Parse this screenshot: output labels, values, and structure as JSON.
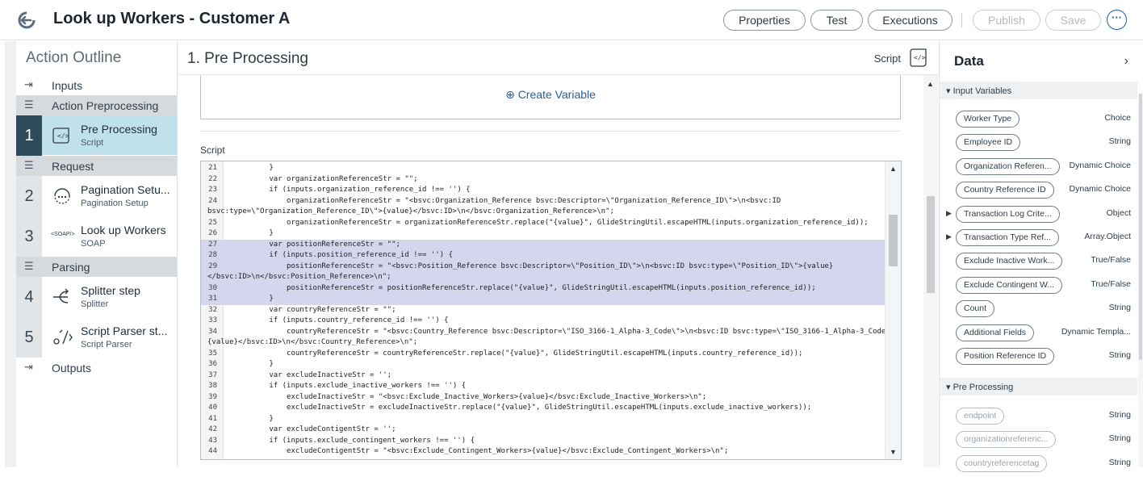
{
  "header": {
    "title": "Look up Workers - Customer A",
    "buttons": {
      "properties": "Properties",
      "test": "Test",
      "executions": "Executions",
      "publish": "Publish",
      "save": "Save",
      "more": "···"
    }
  },
  "outline": {
    "title": "Action Outline",
    "inputs": "Inputs",
    "outputs": "Outputs",
    "sections": [
      "Action Preprocessing",
      "Request",
      "Parsing"
    ],
    "steps": [
      {
        "num": "1",
        "title": "Pre Processing",
        "sub": "Script",
        "icon": "script-icon"
      },
      {
        "num": "2",
        "title": "Pagination Setu...",
        "sub": "Pagination Setup",
        "icon": "pagination-icon"
      },
      {
        "num": "3",
        "title": "Look up Workers",
        "sub": "SOAP",
        "icon": "soap-icon",
        "icon_text": "<SOAP/>"
      },
      {
        "num": "4",
        "title": "Splitter step",
        "sub": "Splitter",
        "icon": "splitter-icon"
      },
      {
        "num": "5",
        "title": "Script Parser st...",
        "sub": "Script Parser",
        "icon": "script-parser-icon"
      }
    ]
  },
  "main": {
    "step_number": "1.",
    "title": "Pre Processing",
    "script_type_label": "Script",
    "create_variable": "Create Variable",
    "script_label": "Script",
    "code_lines": [
      {
        "n": "21",
        "t": "        }"
      },
      {
        "n": "22",
        "t": "        var organizationReferenceStr = \"\";"
      },
      {
        "n": "23",
        "t": "        if (inputs.organization_reference_id !== '') {"
      },
      {
        "n": "24",
        "t": "            organizationReferenceStr = \"<bsvc:Organization_Reference bsvc:Descriptor=\\\"Organization_Reference_ID\\\">\\n<bsvc:ID"
      },
      {
        "n": "",
        "t": "bsvc:type=\\\"Organization_Reference_ID\\\">{value}</bsvc:ID>\\n</bsvc:Organization_Reference>\\n\";"
      },
      {
        "n": "25",
        "t": "            organizationReferenceStr = organizationReferenceStr.replace(\"{value}\", GlideStringUtil.escapeHTML(inputs.organization_reference_id));"
      },
      {
        "n": "26",
        "t": "        }"
      },
      {
        "n": "27",
        "t": "        var positionReferenceStr = \"\";",
        "hl": true
      },
      {
        "n": "28",
        "t": "        if (inputs.position_reference_id !== '') {",
        "hl": true
      },
      {
        "n": "29",
        "t": "            positionReferenceStr = \"<bsvc:Position_Reference bsvc:Descriptor=\\\"Position_ID\\\">\\n<bsvc:ID bsvc:type=\\\"Position_ID\\\">{value}",
        "hl": true
      },
      {
        "n": "",
        "t": "</bsvc:ID>\\n</bsvc:Position_Reference>\\n\";",
        "hl": true
      },
      {
        "n": "30",
        "t": "            positionReferenceStr = positionReferenceStr.replace(\"{value}\", GlideStringUtil.escapeHTML(inputs.position_reference_id));",
        "hl": true
      },
      {
        "n": "31",
        "t": "        }",
        "hl": true
      },
      {
        "n": "32",
        "t": "        var countryReferenceStr = \"\";"
      },
      {
        "n": "33",
        "t": "        if (inputs.country_reference_id !== '') {"
      },
      {
        "n": "34",
        "t": "            countryReferenceStr = \"<bsvc:Country_Reference bsvc:Descriptor=\\\"ISO_3166-1_Alpha-3_Code\\\">\\n<bsvc:ID bsvc:type=\\\"ISO_3166-1_Alpha-3_Code\\\">"
      },
      {
        "n": "",
        "t": "{value}</bsvc:ID>\\n</bsvc:Country_Reference>\\n\";"
      },
      {
        "n": "35",
        "t": "            countryReferenceStr = countryReferenceStr.replace(\"{value}\", GlideStringUtil.escapeHTML(inputs.country_reference_id));"
      },
      {
        "n": "36",
        "t": "        }"
      },
      {
        "n": "37",
        "t": "        var excludeInactiveStr = '';"
      },
      {
        "n": "38",
        "t": "        if (inputs.exclude_inactive_workers !== '') {"
      },
      {
        "n": "39",
        "t": "            excludeInactiveStr = \"<bsvc:Exclude_Inactive_Workers>{value}</bsvc:Exclude_Inactive_Workers>\\n\";"
      },
      {
        "n": "40",
        "t": "            excludeInactiveStr = excludeInactiveStr.replace(\"{value}\", GlideStringUtil.escapeHTML(inputs.exclude_inactive_workers));"
      },
      {
        "n": "41",
        "t": "        }"
      },
      {
        "n": "42",
        "t": "        var excludeContigentStr = '';"
      },
      {
        "n": "43",
        "t": "        if (inputs.exclude_contingent_workers !== '') {"
      },
      {
        "n": "44",
        "t": "            excludeContigentStr = \"<bsvc:Exclude_Contingent_Workers>{value}</bsvc:Exclude_Contingent_Workers>\\n\";"
      }
    ]
  },
  "data_panel": {
    "title": "Data",
    "input_section": "Input Variables",
    "inputs": [
      {
        "name": "Worker Type",
        "type": "Choice"
      },
      {
        "name": "Employee ID",
        "type": "String"
      },
      {
        "name": "Organization Referen...",
        "type": "Dynamic Choice"
      },
      {
        "name": "Country Reference ID",
        "type": "Dynamic Choice"
      },
      {
        "name": "Transaction Log Crite...",
        "type": "Object",
        "expandable": true
      },
      {
        "name": "Transaction Type Ref...",
        "type": "Array.Object",
        "expandable": true
      },
      {
        "name": "Exclude Inactive Work...",
        "type": "True/False"
      },
      {
        "name": "Exclude Contingent W...",
        "type": "True/False"
      },
      {
        "name": "Count",
        "type": "String"
      },
      {
        "name": "Additional Fields",
        "type": "Dynamic Templa..."
      },
      {
        "name": "Position Reference ID",
        "type": "String"
      }
    ],
    "pre_section": "Pre Processing",
    "pre": [
      {
        "name": "endpoint",
        "type": "String"
      },
      {
        "name": "organizationreferenc...",
        "type": "String"
      },
      {
        "name": "countryreferencetag",
        "type": "String"
      }
    ]
  }
}
